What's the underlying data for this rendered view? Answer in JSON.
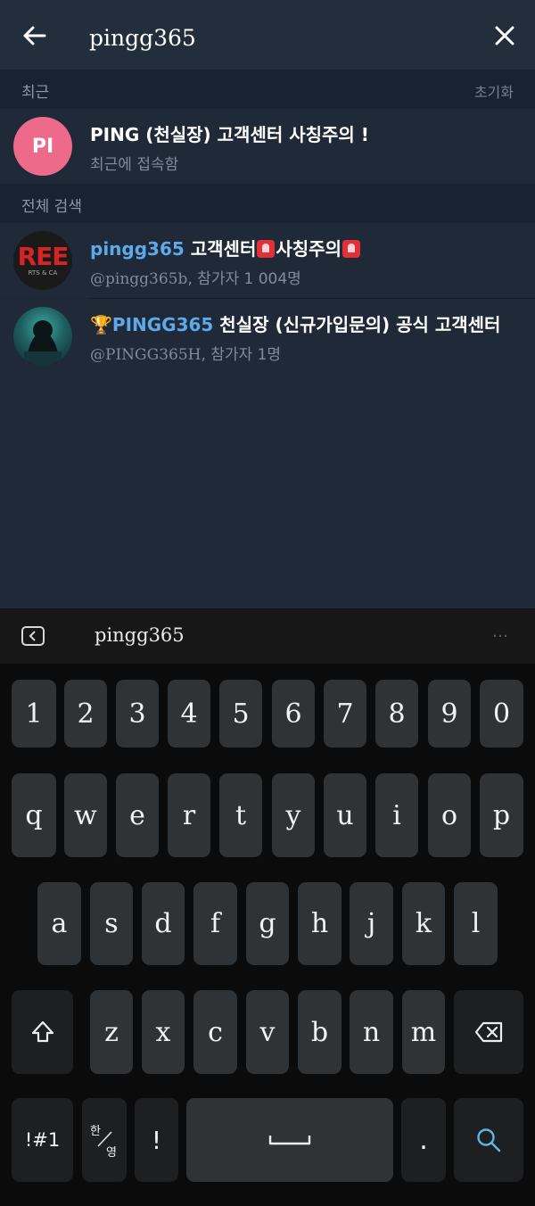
{
  "search": {
    "query": "pingg365"
  },
  "recent": {
    "title": "최근",
    "clear_label": "초기화",
    "items": [
      {
        "avatar_text": "PI",
        "avatar_color": "#ee6a8a",
        "name": "PING (천실장) 고객센터 사칭주의 !",
        "status": "최근에 접속함"
      }
    ]
  },
  "global": {
    "title": "전체 검색",
    "items": [
      {
        "name_highlight": "pingg365",
        "name_rest_1": " 고객센터",
        "name_rest_2": "사칭주의",
        "handle": "@pingg365b",
        "members": ", 참가자 1 004명",
        "avatar_text": "REE",
        "avatar_subtext": "RTS & CA",
        "siren_icon": "police-light-icon"
      },
      {
        "prefix_icon": "🏆",
        "name_highlight": "PINGG365",
        "name_rest": " 천실장 (신규가입문의) 공식 고객센터",
        "handle": "@PINGG365H",
        "members": ", 참가자 1명"
      }
    ]
  },
  "keyboard": {
    "suggestion": "pingg365",
    "more": "…",
    "numbers": [
      "1",
      "2",
      "3",
      "4",
      "5",
      "6",
      "7",
      "8",
      "9",
      "0"
    ],
    "row1": [
      "q",
      "w",
      "e",
      "r",
      "t",
      "y",
      "u",
      "i",
      "o",
      "p"
    ],
    "row2": [
      "a",
      "s",
      "d",
      "f",
      "g",
      "h",
      "j",
      "k",
      "l"
    ],
    "row3": [
      "z",
      "x",
      "c",
      "v",
      "b",
      "n",
      "m"
    ],
    "symbols_label": "!#1",
    "lang_top": "한",
    "lang_bottom": "영",
    "excl": "!",
    "period": "."
  },
  "colors": {
    "accent": "#5da9e9",
    "header_bg": "#222e3c",
    "list_bg": "#1f2937"
  }
}
